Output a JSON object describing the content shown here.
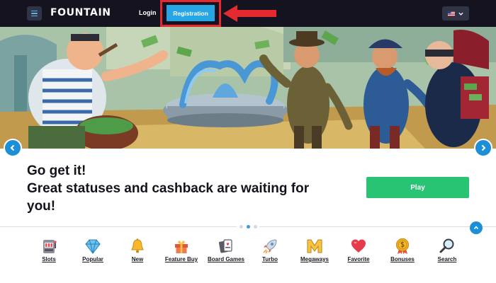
{
  "header": {
    "logo": "FOUNTAIN",
    "login_label": "Login",
    "register_label": "Registration",
    "menu_icon": "hamburger-menu-icon",
    "language_flag": "us-flag-icon",
    "language_caret": "chevron-down-icon",
    "colors": {
      "bar": "#15131f",
      "register_button": "#27a6e6",
      "highlight": "#e52a2f"
    }
  },
  "banner": {
    "prev_icon": "chevron-left-icon",
    "next_icon": "chevron-right-icon"
  },
  "promo": {
    "headline_line1": "Go get it!",
    "headline_line2": "Great statuses and cashback are waiting for you!",
    "play_label": "Play",
    "colors": {
      "play_button": "#28c473"
    }
  },
  "carousel": {
    "slide_count": 3,
    "active_index": 1,
    "scroll_top_icon": "chevron-up-icon"
  },
  "categories": [
    {
      "label": "Slots",
      "icon": "slot-machine-icon"
    },
    {
      "label": "Popular",
      "icon": "diamond-icon"
    },
    {
      "label": "New",
      "icon": "bell-icon"
    },
    {
      "label": "Feature Buy",
      "icon": "gift-icon"
    },
    {
      "label": "Board Games",
      "icon": "cards-icon"
    },
    {
      "label": "Turbo",
      "icon": "rocket-icon"
    },
    {
      "label": "Megaways",
      "icon": "letter-m-icon"
    },
    {
      "label": "Favorite",
      "icon": "heart-icon"
    },
    {
      "label": "Bonuses",
      "icon": "coin-medal-icon"
    },
    {
      "label": "Search",
      "icon": "magnifier-icon"
    }
  ]
}
